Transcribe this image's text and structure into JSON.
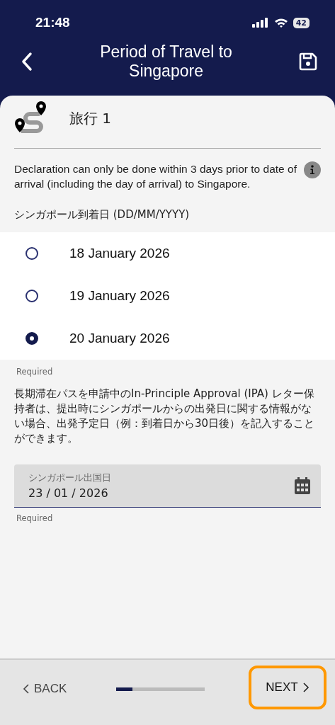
{
  "status_bar": {
    "time": "21:48",
    "battery": "42"
  },
  "header": {
    "title": "Period of Travel to Singapore"
  },
  "trip": {
    "title": "旅行 1"
  },
  "notice": "Declaration can only be done within 3 days prior to date of arrival (including the day of arrival) to Singapore.",
  "arrival": {
    "label": "シンガポール到着日 (DD/MM/YYYY)",
    "options": [
      {
        "label": "18 January 2026",
        "selected": false
      },
      {
        "label": "19 January 2026",
        "selected": false
      },
      {
        "label": "20 January 2026",
        "selected": true
      }
    ],
    "helper": "Required"
  },
  "ipa_note": "長期滞在パスを申請中のIn-Principle Approval (IPA) レター保持者は、提出時にシンガポールからの出発日に関する情報がない場合、出発予定日（例：到着日から30日後）を記入することができます。",
  "departure": {
    "label": "シンガポール出国日",
    "value": "23 / 01 / 2026",
    "helper": "Required"
  },
  "footer": {
    "back": "BACK",
    "next": "NEXT",
    "next_highlighted": true,
    "progress": {
      "level": 0.18
    }
  }
}
